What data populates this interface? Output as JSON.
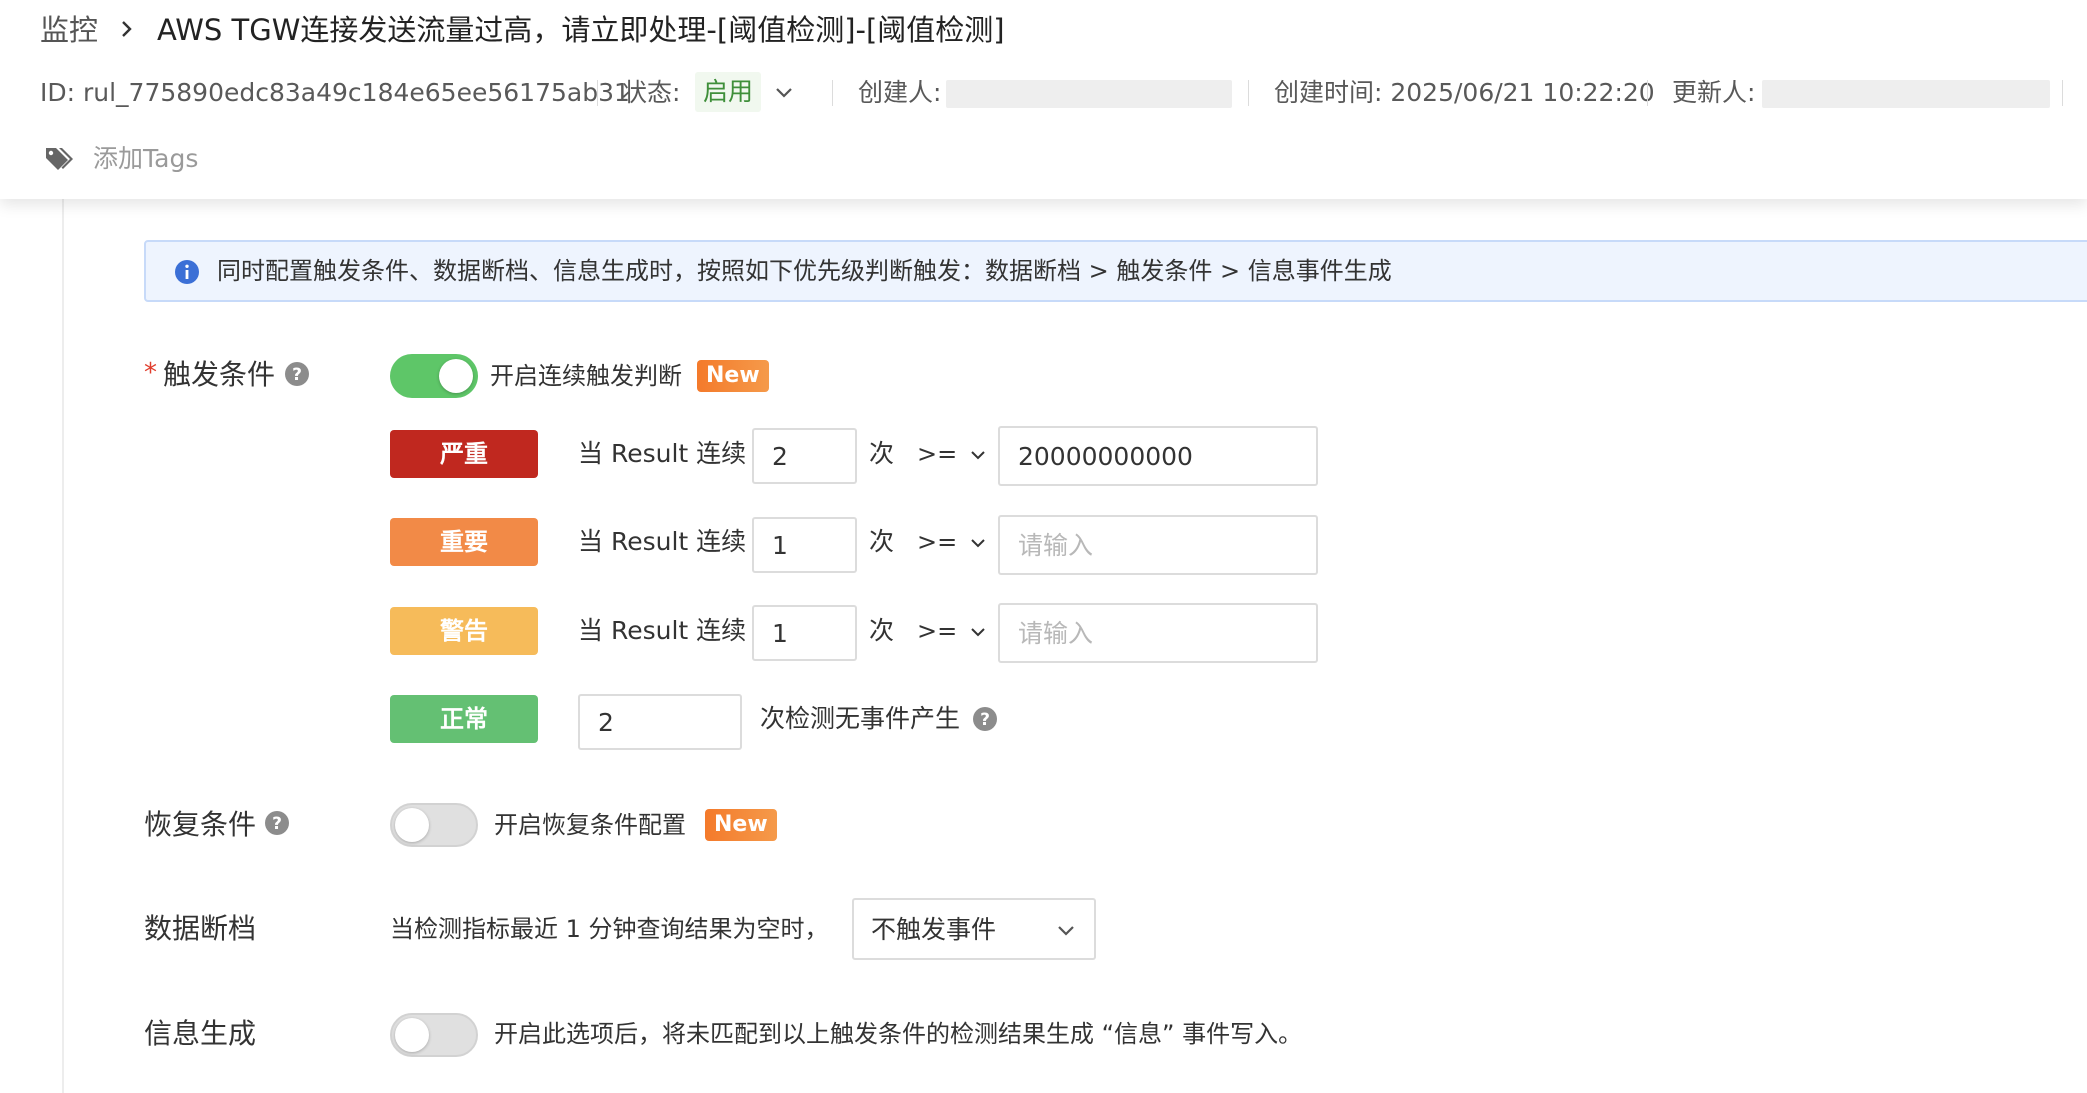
{
  "breadcrumb": {
    "root": "监控",
    "title": "AWS TGW连接发送流量过高，请立即处理-[阈值检测]-[阈值检测]"
  },
  "meta": {
    "id": "ID: rul_775890edc83a49c184e65ee56175ab31",
    "status_label": "状态:",
    "status_value": "启用",
    "creator_label": "创建人:",
    "created_time": "创建时间: 2025/06/21 10:22:20",
    "updater_label": "更新人:"
  },
  "tags": {
    "add_label": "添加Tags"
  },
  "alert": {
    "text": "同时配置触发条件、数据断档、信息生成时，按照如下优先级判断触发：数据断档 > 触发条件 > 信息事件生成"
  },
  "trigger": {
    "star": "*",
    "label": "触发条件",
    "toggle_on": true,
    "toggle_text": "开启连续触发判断",
    "badge": "New",
    "rows": [
      {
        "severity": "严重",
        "color": "#c0281f",
        "prefix": "当 Result 连续",
        "count": "2",
        "unit": "次",
        "op": ">=",
        "value": "20000000000",
        "placeholder": "请输入"
      },
      {
        "severity": "重要",
        "color": "#f28a47",
        "prefix": "当 Result 连续",
        "count": "1",
        "unit": "次",
        "op": ">=",
        "value": "",
        "placeholder": "请输入"
      },
      {
        "severity": "警告",
        "color": "#f6bb5a",
        "prefix": "当 Result 连续",
        "count": "1",
        "unit": "次",
        "op": ">=",
        "value": "",
        "placeholder": "请输入"
      }
    ],
    "normal": {
      "severity": "正常",
      "color": "#64c073",
      "count": "2",
      "text": "次检测无事件产生"
    }
  },
  "recovery": {
    "label": "恢复条件",
    "toggle_on": false,
    "toggle_text": "开启恢复条件配置",
    "badge": "New"
  },
  "nodata": {
    "label": "数据断档",
    "text": "当检测指标最近 1 分钟查询结果为空时，",
    "select_value": "不触发事件"
  },
  "info": {
    "label": "信息生成",
    "toggle_on": false,
    "text": "开启此选项后，将未匹配到以上触发条件的检测结果生成 “信息” 事件写入。"
  },
  "colors": {
    "accent_green": "#5ec668",
    "info_blue": "#3b6fd6",
    "required_red": "#e03e2d"
  }
}
